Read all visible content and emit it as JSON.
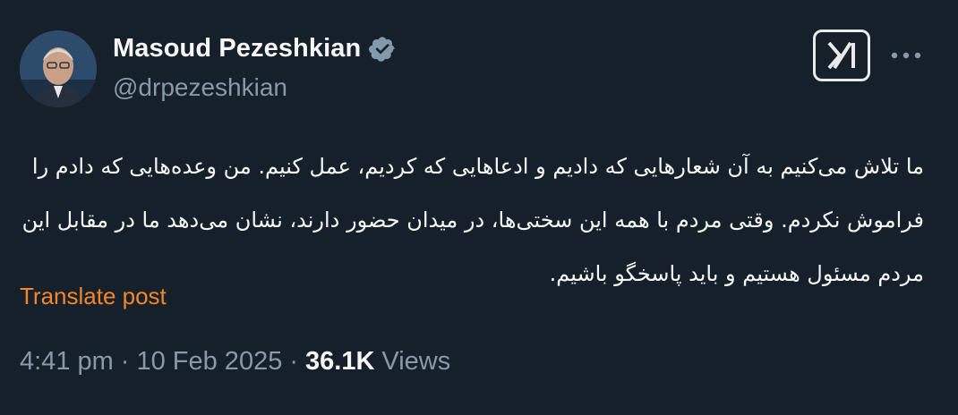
{
  "author": {
    "display_name": "Masoud Pezeshkian",
    "handle": "@drpezeshkian",
    "verified_color": "#829aab",
    "avatar_icon": "profile-photo"
  },
  "post": {
    "text": "ما تلاش می‌کنیم به آن شعارهایی که دادیم و ادعاهایی که کردیم، عمل کنیم. من وعده‌هایی که دادم را فراموش نکردم. وقتی مردم با همه این سختی‌ها، در میدان حضور دارند، نشان می‌دهد ما در مقابل این مردم مسئول هستیم و باید پاسخگو باشیم.",
    "translate_label": "Translate post"
  },
  "meta": {
    "time": "4:41 pm",
    "separator": "·",
    "date": "10 Feb 2025",
    "views_count": "36.1K",
    "views_label": "Views"
  },
  "actions": {
    "grok_icon": "grok-icon",
    "more_icon": "more-horizontal-icon"
  },
  "colors": {
    "background": "#15202b",
    "secondary_text": "#8b98a5",
    "translate_link": "#f58529"
  }
}
